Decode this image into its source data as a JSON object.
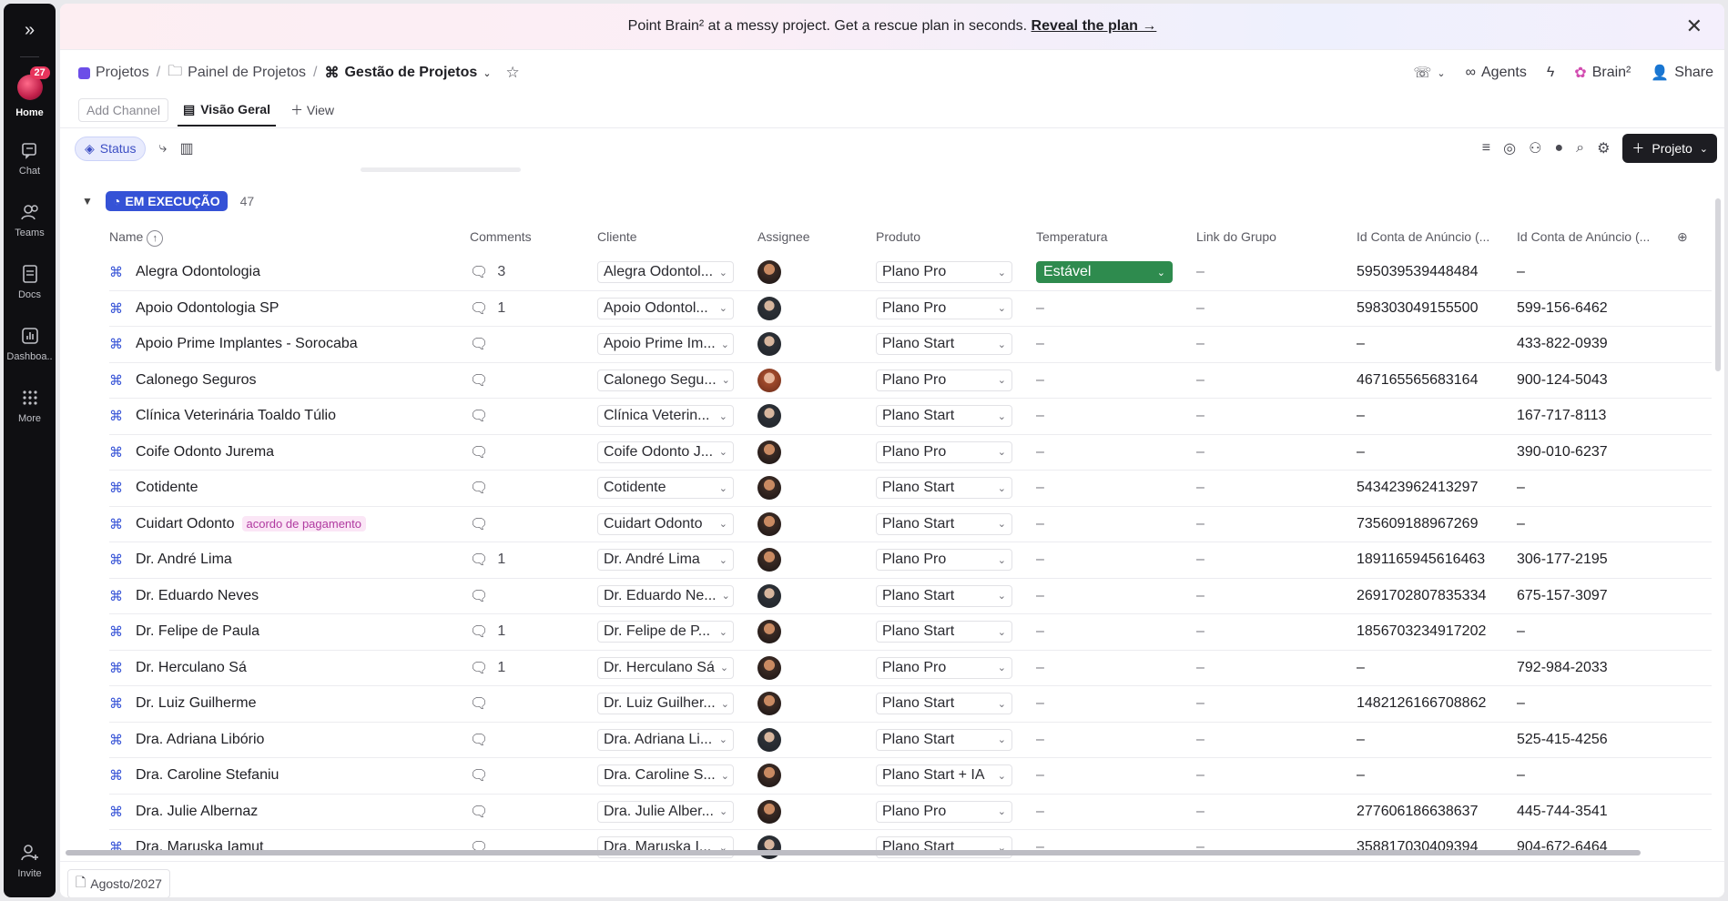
{
  "rail": {
    "home_badge": "27",
    "items": [
      {
        "label": "Home",
        "icon": "home-icon"
      },
      {
        "label": "Chat",
        "icon": "chat-icon"
      },
      {
        "label": "Teams",
        "icon": "teams-icon"
      },
      {
        "label": "Docs",
        "icon": "docs-icon"
      },
      {
        "label": "Dashboa..",
        "icon": "dashboard-icon"
      },
      {
        "label": "More",
        "icon": "grid-icon"
      },
      {
        "label": "Invite",
        "icon": "invite-icon"
      }
    ]
  },
  "banner": {
    "text": "Point Brain² at a messy project. Get a rescue plan in seconds.",
    "link": "Reveal the plan →"
  },
  "breadcrumb": {
    "items": [
      "Projetos",
      "Painel de Projetos",
      "Gestão de Projetos"
    ]
  },
  "header_actions": {
    "agents": "Agents",
    "brain": "Brain²",
    "share": "Share"
  },
  "tabs": {
    "add_channel": "Add Channel",
    "active": "Visão Geral",
    "new_view": "View"
  },
  "toolbar": {
    "status": "Status",
    "new_button": "Projeto"
  },
  "group": {
    "label": "EM EXECUÇÃO",
    "count": "47"
  },
  "columns": [
    "Name",
    "Comments",
    "Cliente",
    "Assignee",
    "Produto",
    "Temperatura",
    "Link do Grupo",
    "Id Conta de Anúncio (...",
    "Id Conta de Anúncio (..."
  ],
  "rows": [
    {
      "name": "Alegra Odontologia",
      "tag": "",
      "comments": "3",
      "cliente": "Alegra Odontol...",
      "produto": "Plano Pro",
      "temp": "Estável",
      "link": "–",
      "id1": "595039539448484",
      "id2": "–",
      "av": "a"
    },
    {
      "name": "Apoio Odontologia SP",
      "tag": "",
      "comments": "1",
      "cliente": "Apoio Odontol...",
      "produto": "Plano Pro",
      "temp": "–",
      "link": "–",
      "id1": "598303049155500",
      "id2": "599-156-6462",
      "av": "b"
    },
    {
      "name": "Apoio Prime Implantes - Sorocaba",
      "tag": "",
      "comments": "",
      "cliente": "Apoio Prime Im...",
      "produto": "Plano Start",
      "temp": "–",
      "link": "–",
      "id1": "–",
      "id2": "433-822-0939",
      "av": "b"
    },
    {
      "name": "Calonego Seguros",
      "tag": "",
      "comments": "",
      "cliente": "Calonego Segu...",
      "produto": "Plano Pro",
      "temp": "–",
      "link": "–",
      "id1": "467165565683164",
      "id2": "900-124-5043",
      "av": "c"
    },
    {
      "name": "Clínica Veterinária Toaldo Túlio",
      "tag": "",
      "comments": "",
      "cliente": "Clínica Veterin...",
      "produto": "Plano Start",
      "temp": "–",
      "link": "–",
      "id1": "–",
      "id2": "167-717-8113",
      "av": "b"
    },
    {
      "name": "Coife Odonto Jurema",
      "tag": "",
      "comments": "",
      "cliente": "Coife Odonto J...",
      "produto": "Plano Pro",
      "temp": "–",
      "link": "–",
      "id1": "–",
      "id2": "390-010-6237",
      "av": "a"
    },
    {
      "name": "Cotidente",
      "tag": "",
      "comments": "",
      "cliente": "Cotidente",
      "produto": "Plano Start",
      "temp": "–",
      "link": "–",
      "id1": "543423962413297",
      "id2": "–",
      "av": "a"
    },
    {
      "name": "Cuidart Odonto",
      "tag": "acordo de pagamento",
      "comments": "",
      "cliente": "Cuidart Odonto",
      "produto": "Plano Start",
      "temp": "–",
      "link": "–",
      "id1": "735609188967269",
      "id2": "–",
      "av": "a"
    },
    {
      "name": "Dr. André Lima",
      "tag": "",
      "comments": "1",
      "cliente": "Dr. André Lima",
      "produto": "Plano Pro",
      "temp": "–",
      "link": "–",
      "id1": "1891165945616463",
      "id2": "306-177-2195",
      "av": "a"
    },
    {
      "name": "Dr. Eduardo Neves",
      "tag": "",
      "comments": "",
      "cliente": "Dr. Eduardo Ne...",
      "produto": "Plano Start",
      "temp": "–",
      "link": "–",
      "id1": "2691702807835334",
      "id2": "675-157-3097",
      "av": "b"
    },
    {
      "name": "Dr. Felipe de Paula",
      "tag": "",
      "comments": "1",
      "cliente": "Dr. Felipe de P...",
      "produto": "Plano Start",
      "temp": "–",
      "link": "–",
      "id1": "1856703234917202",
      "id2": "–",
      "av": "a"
    },
    {
      "name": "Dr. Herculano Sá",
      "tag": "",
      "comments": "1",
      "cliente": "Dr. Herculano Sá",
      "produto": "Plano Pro",
      "temp": "–",
      "link": "–",
      "id1": "–",
      "id2": "792-984-2033",
      "av": "a"
    },
    {
      "name": "Dr. Luiz Guilherme",
      "tag": "",
      "comments": "",
      "cliente": "Dr. Luiz Guilher...",
      "produto": "Plano Start",
      "temp": "–",
      "link": "–",
      "id1": "1482126166708862",
      "id2": "–",
      "av": "a"
    },
    {
      "name": "Dra. Adriana Libório",
      "tag": "",
      "comments": "",
      "cliente": "Dra. Adriana Li...",
      "produto": "Plano Start",
      "temp": "–",
      "link": "–",
      "id1": "–",
      "id2": "525-415-4256",
      "av": "b"
    },
    {
      "name": "Dra. Caroline Stefaniu",
      "tag": "",
      "comments": "",
      "cliente": "Dra. Caroline S...",
      "produto": "Plano Start + IA",
      "temp": "–",
      "link": "–",
      "id1": "–",
      "id2": "–",
      "av": "a"
    },
    {
      "name": "Dra. Julie Albernaz",
      "tag": "",
      "comments": "",
      "cliente": "Dra. Julie Alber...",
      "produto": "Plano Pro",
      "temp": "–",
      "link": "–",
      "id1": "277606186638637",
      "id2": "445-744-3541",
      "av": "a"
    },
    {
      "name": "Dra. Maruska Iamut",
      "tag": "",
      "comments": "",
      "cliente": "Dra. Maruska I...",
      "produto": "Plano Start",
      "temp": "–",
      "link": "–",
      "id1": "358817030409394",
      "id2": "904-672-6464",
      "av": "b"
    }
  ],
  "bottom": {
    "page_chip": "Agosto/2027"
  },
  "colors": {
    "accent": "#3552d6",
    "temp_ok": "#2e8b4e",
    "tag_bg": "#fbe6f6"
  }
}
